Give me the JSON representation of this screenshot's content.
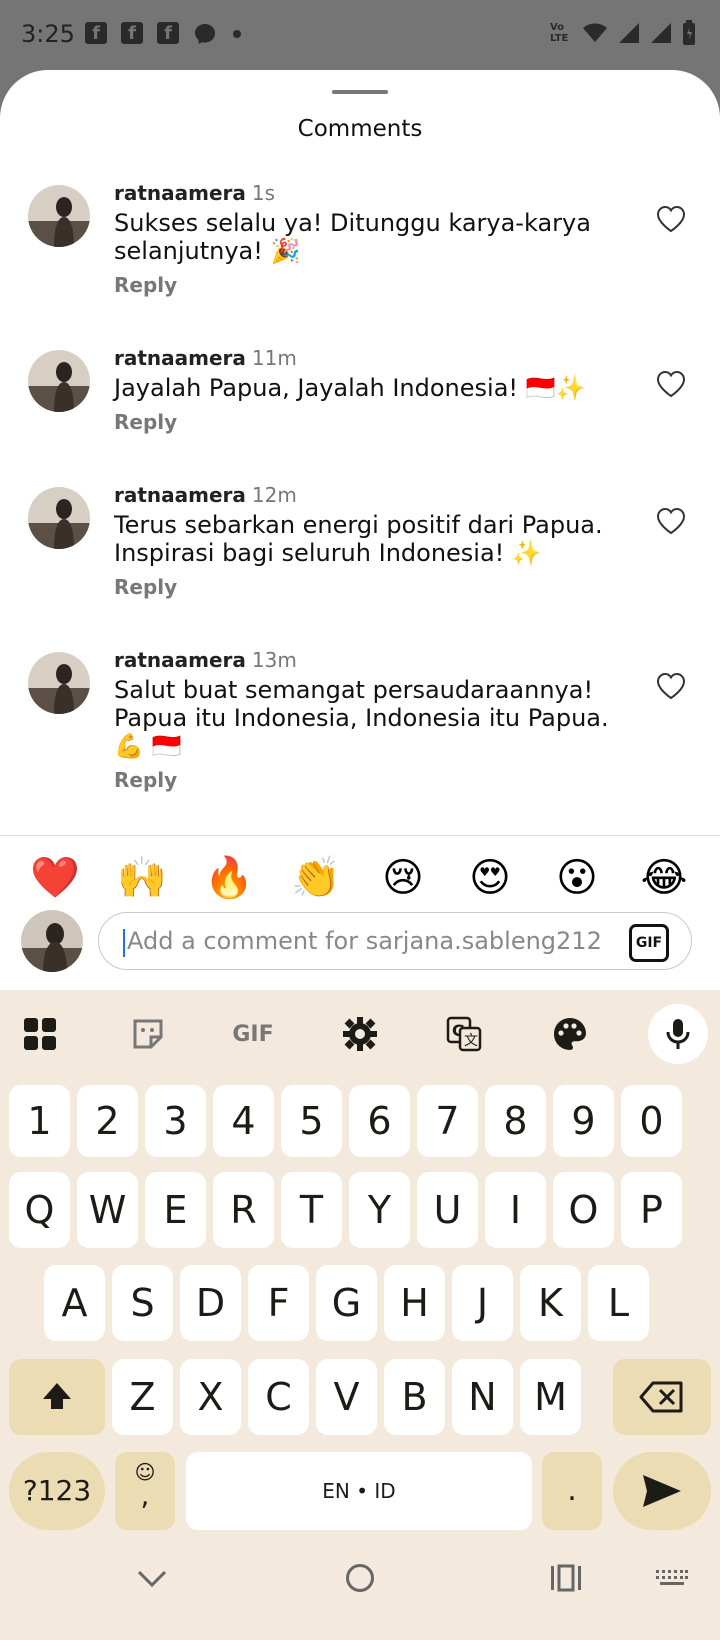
{
  "status_bar": {
    "time": "3:25",
    "network_label": "Vo LTE"
  },
  "sheet": {
    "title": "Comments"
  },
  "comments": [
    {
      "user": "ratnaamera",
      "time": "1s",
      "text": "Sukses selalu ya! Ditunggu karya-karya selanjutnya! 🎉",
      "reply": "Reply"
    },
    {
      "user": "ratnaamera",
      "time": "11m",
      "text": "Jayalah Papua, Jayalah Indonesia! 🇮🇩✨",
      "reply": "Reply"
    },
    {
      "user": "ratnaamera",
      "time": "12m",
      "text": "Terus sebarkan energi positif dari Papua. Inspirasi bagi seluruh Indonesia! ✨",
      "reply": "Reply"
    },
    {
      "user": "ratnaamera",
      "time": "13m",
      "text": "Salut buat semangat persaudaraannya! Papua itu Indonesia, Indonesia itu Papua. 💪 🇮🇩",
      "reply": "Reply"
    }
  ],
  "emoji_bar": [
    "❤️",
    "🙌",
    "🔥",
    "👏",
    "😢",
    "😍",
    "😮",
    "😂"
  ],
  "comment_input": {
    "placeholder": "Add a comment for sarjana.sableng212",
    "gif_label": "GIF"
  },
  "keyboard": {
    "toolbar_gif": "GIF",
    "number_row": [
      "1",
      "2",
      "3",
      "4",
      "5",
      "6",
      "7",
      "8",
      "9",
      "0"
    ],
    "row1": [
      "Q",
      "W",
      "E",
      "R",
      "T",
      "Y",
      "U",
      "I",
      "O",
      "P"
    ],
    "row2": [
      "A",
      "S",
      "D",
      "F",
      "G",
      "H",
      "J",
      "K",
      "L"
    ],
    "row3": [
      "Z",
      "X",
      "C",
      "V",
      "B",
      "N",
      "M"
    ],
    "symbols_key": "?123",
    "emoji_comma_key": ",",
    "space_label": "EN • ID",
    "period_key": "."
  },
  "colors": {
    "keyboard_bg": "#f3e9dc",
    "special_key": "#ecdcb4",
    "status_bg": "#757575"
  }
}
